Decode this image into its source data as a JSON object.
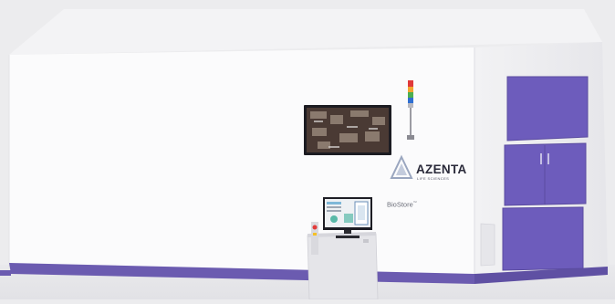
{
  "brand": {
    "name": "AZENTA",
    "tagline": "LIFE SCIENCES",
    "product": "BioStore",
    "trademark": "™"
  },
  "colors": {
    "background": "#ececee",
    "cabinet_white": "#fbfbfc",
    "accent_purple": "#6b5bb0",
    "door_purple": "#6d5cbc"
  },
  "icons": [
    "azenta-logo-icon",
    "signal-tower-icon"
  ]
}
